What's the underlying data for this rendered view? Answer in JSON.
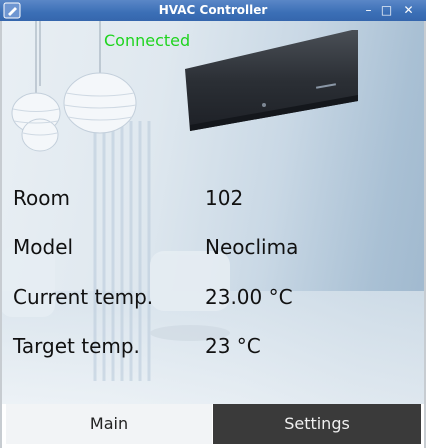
{
  "window": {
    "title": "HVAC Controller",
    "minimize_glyph": "–",
    "maximize_glyph": "□",
    "close_glyph": "✕"
  },
  "status": {
    "text": "Connected",
    "color": "#1fd41f"
  },
  "info": {
    "rows": [
      {
        "label": "Room",
        "value": "102"
      },
      {
        "label": "Model",
        "value": "Neoclima"
      },
      {
        "label": "Current temp.",
        "value": "23.00 °C"
      },
      {
        "label": "Target temp.",
        "value": "23 °C"
      }
    ]
  },
  "tabs": [
    {
      "label": "Main",
      "selected": true
    },
    {
      "label": "Settings",
      "selected": false
    }
  ],
  "icons": {
    "app": "app-pencil-icon",
    "minimize": "minimize-icon",
    "maximize": "maximize-icon",
    "close": "close-icon"
  }
}
